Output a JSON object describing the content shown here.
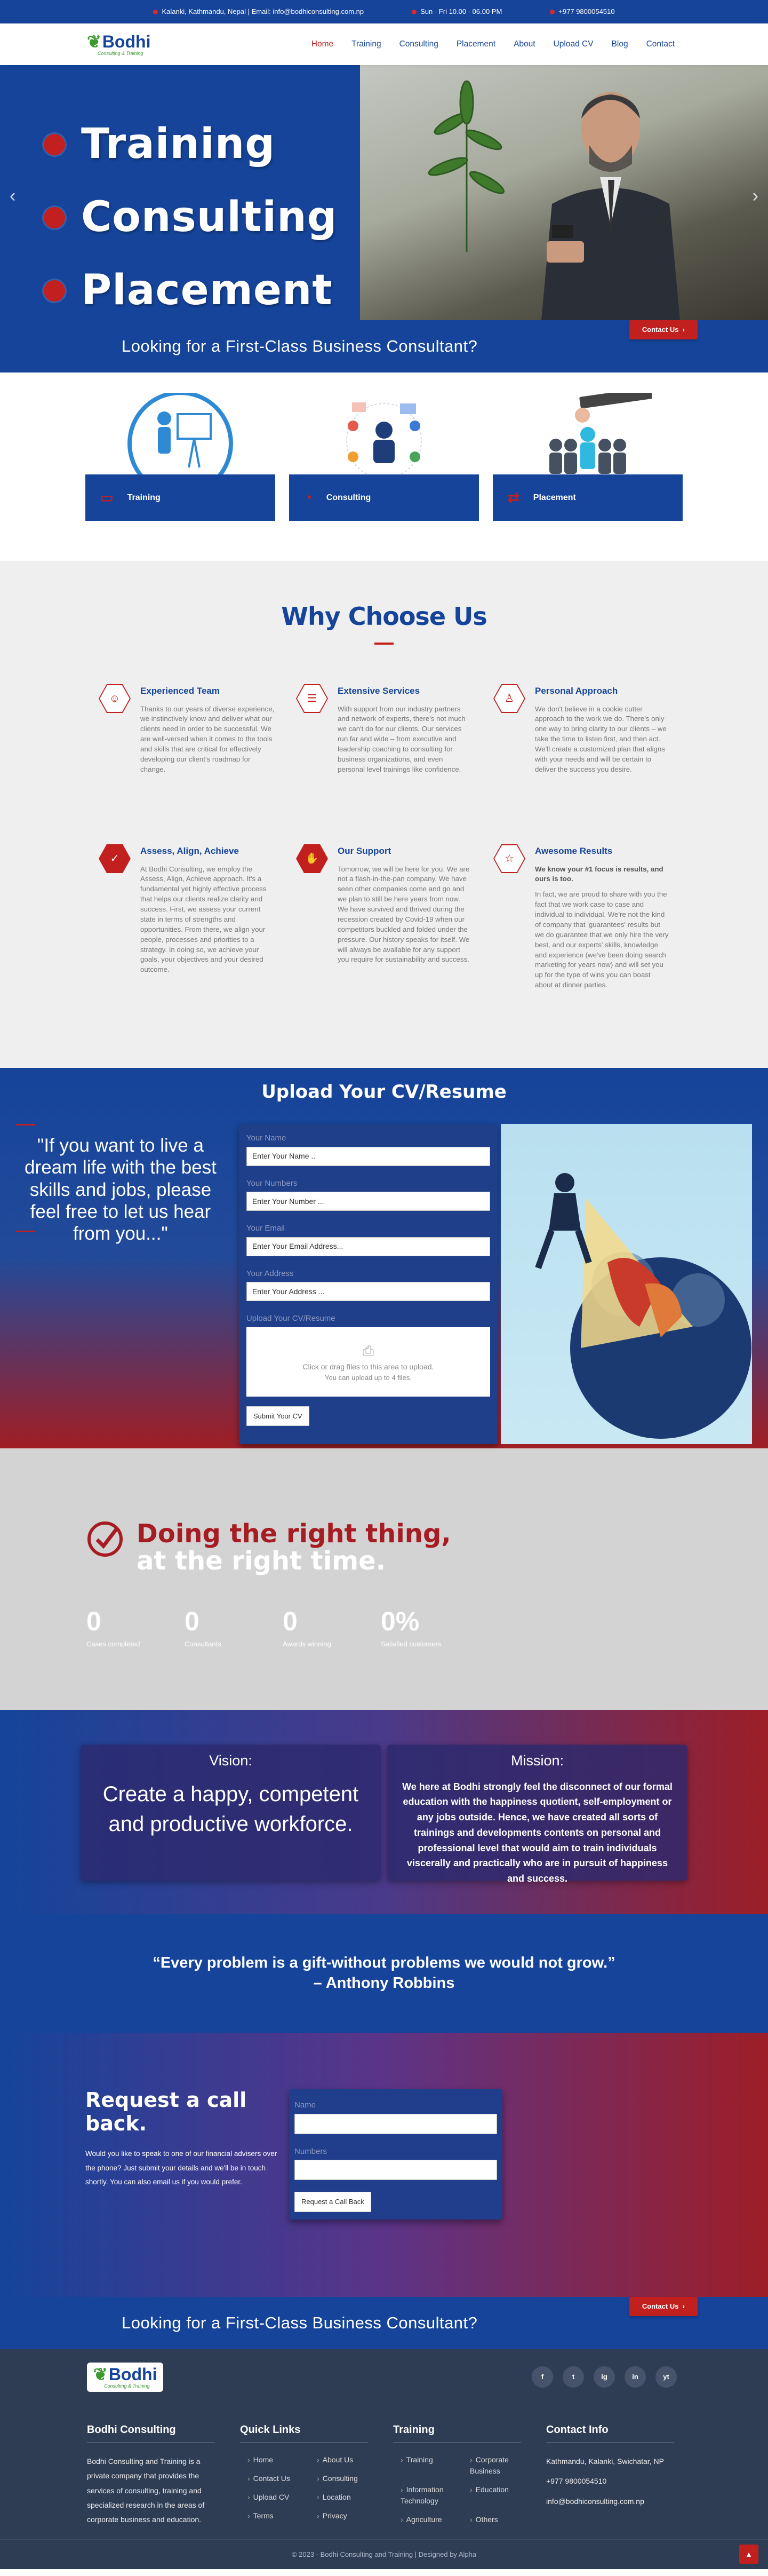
{
  "topbar": {
    "location": "Kalanki, Kathmandu, Nepal | Email: info@bodhiconsulting.com.np",
    "hours": "Sun - Fri 10.00 - 06.00 PM",
    "phone": "+977 9800054510"
  },
  "brand": {
    "name": "Bodhi",
    "tagline": "Consulting & Training",
    "accent": "#15449a",
    "red": "#c21f1f"
  },
  "menu": [
    "Home",
    "Training",
    "Consulting",
    "Placement",
    "About",
    "Upload CV",
    "Blog",
    "Contact"
  ],
  "hero": {
    "lines": [
      "Training",
      "Consulting",
      "Placement"
    ]
  },
  "band": {
    "title": "Looking for a First-Class Business Consultant?",
    "button": "Contact Us"
  },
  "services": [
    {
      "label": "Training",
      "icon": "training-icon"
    },
    {
      "label": "Consulting",
      "icon": "consulting-icon"
    },
    {
      "label": "Placement",
      "icon": "placement-icon"
    }
  ],
  "why": {
    "title": "Why Choose Us",
    "items": [
      {
        "title": "Experienced Team",
        "icon": "team-icon",
        "text": "Thanks to our years of diverse experience, we instinctively know and deliver what our clients need in order to be successful. We are well-versed when it comes to the tools and skills that are critical for effectively developing our client's roadmap for change."
      },
      {
        "title": "Extensive Services",
        "icon": "list-icon",
        "text": "With support from our industry partners and network of experts, there's not much we can't do for our clients. Our services run far and wide – from executive and leadership coaching to consulting for business organizations, and even personal level trainings like confidence."
      },
      {
        "title": "Personal Approach",
        "icon": "person-icon",
        "text": "We don't believe in a cookie cutter approach to the work we do. There's only one way to bring clarity to our clients – we take the time to listen first, and then act. We'll create a customized plan that aligns with your needs and will be certain to deliver the success you desire."
      },
      {
        "title": "Assess, Align, Achieve",
        "icon": "check-icon",
        "text": "At Bodhi Consulting, we employ the Assess, Align, Achieve approach. It's a fundamental yet highly effective process that helps our clients realize clarity and success. First, we assess your current state in terms of strengths and opportunities. From there, we align your people, processes and priorities to a strategy. In doing so, we achieve your goals, your objectives and your desired outcome."
      },
      {
        "title": "Our Support",
        "icon": "handshake-icon",
        "text": "Tomorrow, we will be here for you. We are not a flash-in-the-pan company. We have seen other companies come and go and we plan to still be here years from now. We have survived and thrived during the recession created by Covid-19 when our competitors buckled and folded under the pressure. Our history speaks for itself. We will always be available for any support you require for sustainability and success."
      },
      {
        "title": "Awesome Results",
        "icon": "star-icon",
        "lead": "We know your #1 focus is results, and ours is too.",
        "text": "In fact, we are proud to share with you the fact that we work case to case and individual to individual. We're not the kind of company that 'guarantees' results but we do guarantee that we only hire the very best, and our experts' skills, knowledge and experience (we've been doing search marketing for years now) and will set you up for the type of wins you can boast about at dinner parties."
      }
    ]
  },
  "upload": {
    "title": "Upload Your CV/Resume",
    "quote": "\"If you want to live a dream life with the best skills and jobs, please feel free to let us hear from you...\"",
    "fields": [
      {
        "label": "Your Name",
        "placeholder": "Enter Your Name .."
      },
      {
        "label": "Your Numbers",
        "placeholder": "Enter Your Number ..."
      },
      {
        "label": "Your Email",
        "placeholder": "Enter Your Email Address..."
      },
      {
        "label": "Your Address",
        "placeholder": "Enter Your Address ..."
      }
    ],
    "cv_label": "Upload Your CV/Resume",
    "drop_text": "Click or drag files to this area to upload.",
    "drop_sub": "You can upload up to 4 files.",
    "submit": "Submit Your CV"
  },
  "right_thing": {
    "title_a": "Doing the right thing,",
    "title_b": "at the right time.",
    "stats": [
      {
        "n": "0",
        "l": "Cases completed"
      },
      {
        "n": "0",
        "l": "Consultants"
      },
      {
        "n": "0",
        "l": "Awards winning"
      },
      {
        "n": "0%",
        "l": "Satisfied customers"
      }
    ]
  },
  "vision": {
    "heading": "Vision:",
    "text": "Create a happy, competent and productive workforce."
  },
  "mission": {
    "heading": "Mission:",
    "text": "We here at Bodhi strongly feel the disconnect of our formal education with the happiness quotient, self-employment or any jobs outside. Hence, we have created all sorts of trainings and developments contents on personal and professional level that would aim to train individuals viscerally and practically who are in pursuit of happiness and success."
  },
  "quote": {
    "line1": "“Every problem is a gift-without problems we would not grow.”",
    "line2": "– Anthony Robbins"
  },
  "callback": {
    "title": "Request a call back.",
    "text": "Would you like to speak to one of our financial advisers over the phone? Just submit your details and we'll be in touch shortly. You can also email us if you would prefer.",
    "name_label": "Name",
    "number_label": "Numbers",
    "button": "Request a Call Back"
  },
  "footer": {
    "socials": [
      "f",
      "t",
      "ig",
      "in",
      "yt"
    ],
    "about_title": "Bodhi Consulting",
    "about_text": "Bodhi Consulting and Training is a private company that provides the services of consulting, training and specialized research in the areas of corporate business and education.",
    "links_title": "Quick Links",
    "links": [
      "Home",
      "About Us",
      "Contact Us",
      "Consulting",
      "Upload CV",
      "Location",
      "Terms",
      "Privacy"
    ],
    "training_title": "Training",
    "training": [
      "Training",
      "Corporate Business",
      "Information Technology",
      "Education",
      "Agriculture",
      "Others"
    ],
    "contact_title": "Contact Info",
    "contact": [
      "Kathmandu, Kalanki, Swichatar, NP",
      "+977 9800054510",
      "info@bodhiconsulting.com.np"
    ],
    "copyright": "© 2023 - Bodhi Consulting and Training | Designed by Alpha"
  }
}
